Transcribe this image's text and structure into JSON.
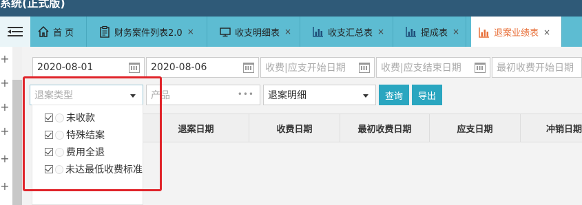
{
  "app": {
    "title": "系统(正式版)"
  },
  "tabs": [
    {
      "label": "首 页",
      "icon": "home-icon",
      "closable": false,
      "active": false
    },
    {
      "label": "财务案件列表2.0",
      "icon": "clipboard-icon",
      "closable": true,
      "active": false
    },
    {
      "label": "收支明细表",
      "icon": "monitor-icon",
      "closable": true,
      "active": false
    },
    {
      "label": "收支汇总表",
      "icon": "bar-chart-icon",
      "closable": true,
      "active": false
    },
    {
      "label": "提成表",
      "icon": "bar-chart-icon",
      "closable": true,
      "active": false
    },
    {
      "label": "退案业绩表",
      "icon": "bar-chart-icon",
      "closable": true,
      "active": true
    }
  ],
  "tab_close_glyph": "×",
  "filters": {
    "date_from": "2020-08-01",
    "date_to": "2020-08-06",
    "pay_start_placeholder": "收费|应支开始日期",
    "pay_end_placeholder": "收费|应支结束日期",
    "first_pay_start_placeholder": "最初收费开始日期",
    "type_placeholder": "退案类型",
    "product_placeholder": "产品",
    "detail_select": "退案明细",
    "query_button": "查询",
    "export_button": "导出"
  },
  "type_options": [
    "未收款",
    "特殊结案",
    "费用全退",
    "未达最低收费标准"
  ],
  "table": {
    "columns": [
      "退案日期",
      "收费日期",
      "最初收费日期",
      "应支日期",
      "冲销日期"
    ]
  },
  "colors": {
    "topbar": "#2f5a78",
    "tabbar": "#5dbcd2",
    "active_tab_text": "#e8703a",
    "button": "#2aa6c0",
    "highlight": "#e0242a"
  }
}
